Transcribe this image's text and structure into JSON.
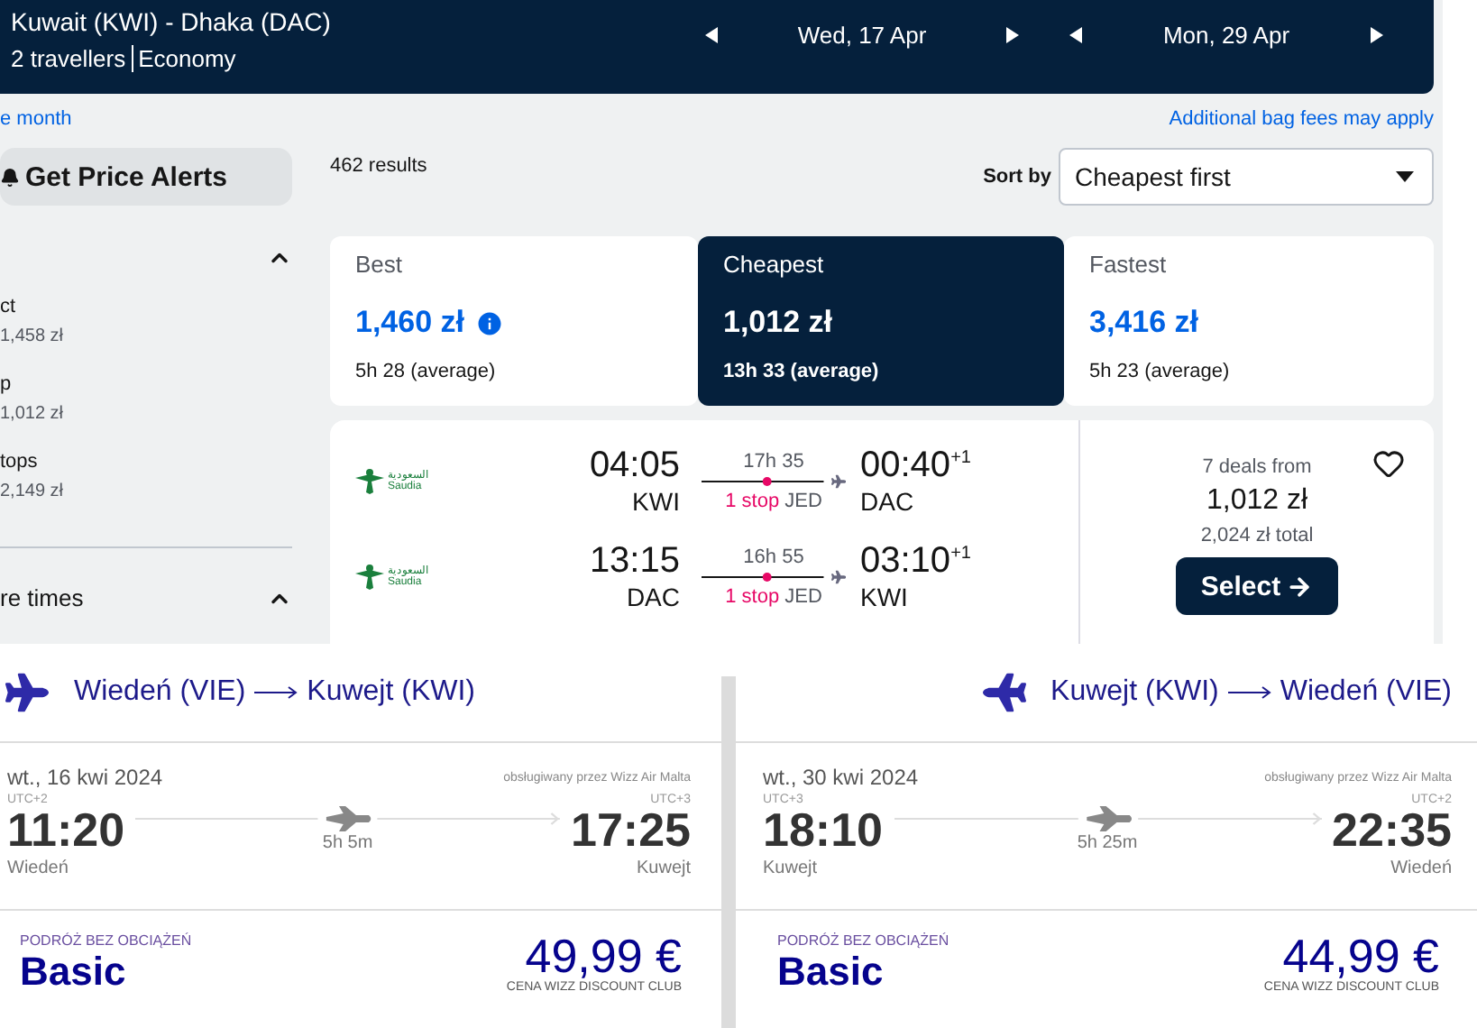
{
  "header": {
    "route": "Kuwait (KWI) - Dhaka (DAC)",
    "travellers": "2 travellers",
    "cabin": "Economy",
    "dates": [
      "Wed, 17 Apr",
      "Mon, 29 Apr"
    ]
  },
  "links": {
    "month": "e month",
    "bag_fees": "Additional bag fees may apply"
  },
  "sidebar": {
    "alert_button": "Get Price Alerts",
    "stops_expanded": true,
    "stops": [
      {
        "label": "ct",
        "price": "1,458 zł"
      },
      {
        "label": "p",
        "price": "1,012 zł"
      },
      {
        "label": "tops",
        "price": "2,149 zł"
      }
    ],
    "times_section": {
      "label": "re times",
      "expanded": true
    }
  },
  "results": {
    "count": "462 results",
    "sort_label": "Sort by",
    "sort_value": "Cheapest first",
    "tabs": [
      {
        "label": "Best",
        "price": "1,460 zł",
        "duration": "5h 28 (average)",
        "info_icon": true,
        "selected": false
      },
      {
        "label": "Cheapest",
        "price": "1,012 zł",
        "duration": "13h 33 (average)",
        "info_icon": false,
        "selected": true
      },
      {
        "label": "Fastest",
        "price": "3,416 zł",
        "duration": "5h 23 (average)",
        "info_icon": false,
        "selected": false
      }
    ]
  },
  "itinerary": {
    "legs": [
      {
        "airline": "Saudia",
        "airline_ar": "السعودية",
        "depart": "04:05",
        "from": "KWI",
        "duration": "17h 35",
        "stops": "1 stop",
        "via": "JED",
        "arrive": "00:40",
        "day_offset": "+1",
        "to": "DAC"
      },
      {
        "airline": "Saudia",
        "airline_ar": "السعودية",
        "depart": "13:15",
        "from": "DAC",
        "duration": "16h 55",
        "stops": "1 stop",
        "via": "JED",
        "arrive": "03:10",
        "day_offset": "+1",
        "to": "KWI"
      }
    ],
    "deals": "7 deals from",
    "price": "1,012 zł",
    "total": "2,024 zł total",
    "select": "Select",
    "saved": false
  },
  "wizz_cards": [
    {
      "route_from": "Wiedeń (VIE)",
      "route_to": "Kuwejt (KWI)",
      "date": "wt., 16 kwi 2024",
      "operator": "obsługiwany przez Wizz Air Malta",
      "depart_tz": "UTC+2",
      "depart": "11:20",
      "depart_city": "Wiedeń",
      "duration": "5h 5m",
      "arrive_tz": "UTC+3",
      "arrive": "17:25",
      "arrive_city": "Kuwejt",
      "fare_tag": "PODRÓŻ BEZ OBCIĄŻEŃ",
      "fare": "Basic",
      "price": "49,99 €",
      "price_note": "CENA WIZZ DISCOUNT CLUB"
    },
    {
      "route_from": "Kuwejt (KWI)",
      "route_to": "Wiedeń (VIE)",
      "date": "wt., 30 kwi 2024",
      "operator": "obsługiwany przez Wizz Air Malta",
      "depart_tz": "UTC+3",
      "depart": "18:10",
      "depart_city": "Kuwejt",
      "duration": "5h 25m",
      "arrive_tz": "UTC+2",
      "arrive": "22:35",
      "arrive_city": "Wiedeń",
      "fare_tag": "PODRÓŻ BEZ OBCIĄŻEŃ",
      "fare": "Basic",
      "price": "44,99 €",
      "price_note": "CENA WIZZ DISCOUNT CLUB"
    }
  ]
}
